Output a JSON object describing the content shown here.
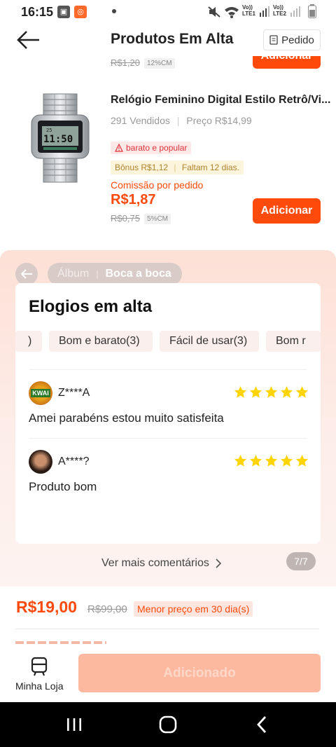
{
  "status": {
    "time": "16:15",
    "lte1": "LTE1",
    "lte2": "LTE2",
    "volte1": "Vo))",
    "volte2": "Vo))"
  },
  "header": {
    "title": "Produtos Em Alta",
    "pedido_label": "Pedido"
  },
  "product_prev": {
    "old_price": "R$1,20",
    "cm": "12%CM",
    "add_label": "Adicionar"
  },
  "product": {
    "name": "Relógio Feminino Digital Estilo Retrô/Vi...",
    "sold": "291 Vendidos",
    "price_text": "Preço R$14,99",
    "tag": "barato e popular",
    "bonus": "Bônus R$1,12",
    "remaining": "Faltam 12 dias.",
    "commission_label": "Comissão por pedido",
    "commission": "R$1,87",
    "old_price": "R$0,75",
    "cm": "5%CM",
    "add_label": "Adicionar",
    "watch_time": "11:50",
    "watch_date": "25"
  },
  "overlay": {
    "tab_album": "Álbum",
    "tab_boca": "Boca a boca",
    "card_title": "Elogios em alta",
    "chips": [
      ")",
      "Bom e barato(3)",
      "Fácil de usar(3)",
      "Bom r"
    ],
    "reviews": [
      {
        "user": "Z****A",
        "text": "Amei parabéns estou muito satisfeita",
        "stars": 5,
        "avatar_text": "KWAI"
      },
      {
        "user": "A****?",
        "text": "Produto bom",
        "stars": 5
      }
    ],
    "see_more": "Ver mais comentários",
    "counter": "7/7"
  },
  "price_area": {
    "price": "R$19,00",
    "old_price": "R$99,00",
    "lowest": "Menor preço em 30 dia(s)"
  },
  "bottom": {
    "store_label": "Minha Loja",
    "add_label": "Adicionado"
  },
  "colors": {
    "accent": "#fe4a0a",
    "star": "#ffd400"
  }
}
